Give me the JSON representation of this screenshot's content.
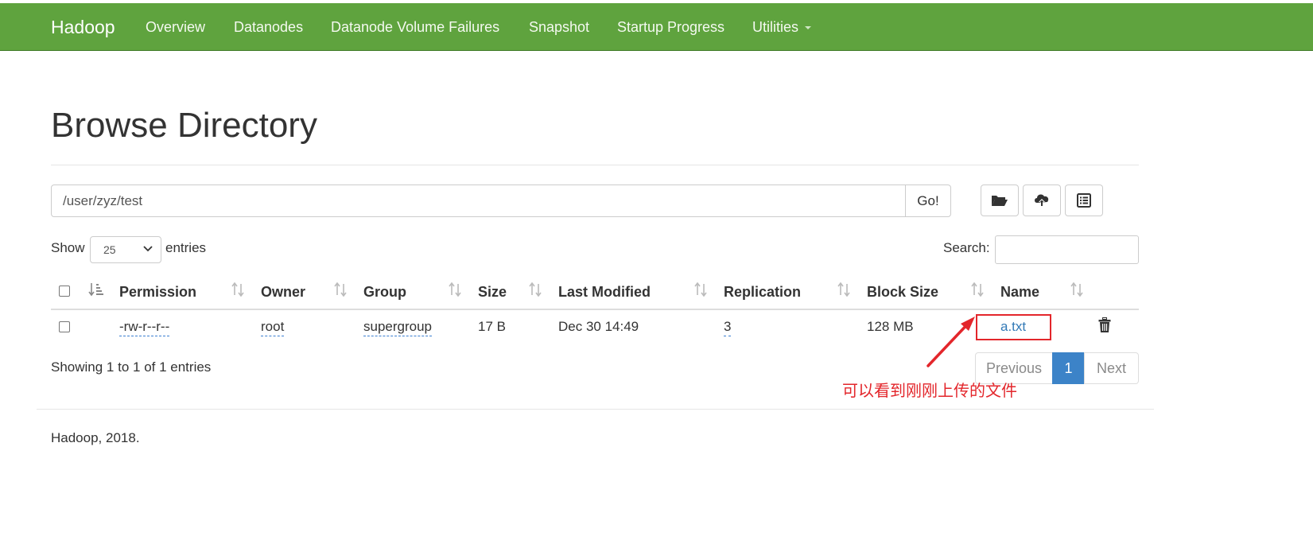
{
  "navbar": {
    "brand": "Hadoop",
    "items": [
      "Overview",
      "Datanodes",
      "Datanode Volume Failures",
      "Snapshot",
      "Startup Progress",
      "Utilities"
    ]
  },
  "page": {
    "title": "Browse Directory"
  },
  "path": {
    "value": "/user/zyz/test",
    "go_label": "Go!"
  },
  "toolbar": {
    "icons": [
      "folder-open-icon",
      "cloud-upload-icon",
      "list-alt-icon"
    ]
  },
  "table_controls": {
    "show_label": "Show",
    "entries_value": "25",
    "entries_label": "entries",
    "search_label": "Search:"
  },
  "table": {
    "headers": [
      "Permission",
      "Owner",
      "Group",
      "Size",
      "Last Modified",
      "Replication",
      "Block Size",
      "Name"
    ],
    "rows": [
      {
        "permission": "-rw-r--r--",
        "owner": "root",
        "group": "supergroup",
        "size": "17 B",
        "last_modified": "Dec 30 14:49",
        "replication": "3",
        "block_size": "128 MB",
        "name": "a.txt"
      }
    ]
  },
  "pagination": {
    "info": "Showing 1 to 1 of 1 entries",
    "previous": "Previous",
    "current": "1",
    "next": "Next"
  },
  "annotation": {
    "text": "可以看到刚刚上传的文件",
    "color": "#e3262b"
  },
  "footer": {
    "text": "Hadoop, 2018."
  },
  "colors": {
    "navbar": "#5fa33e",
    "link": "#337ab7",
    "active_page": "#3c83c8"
  }
}
